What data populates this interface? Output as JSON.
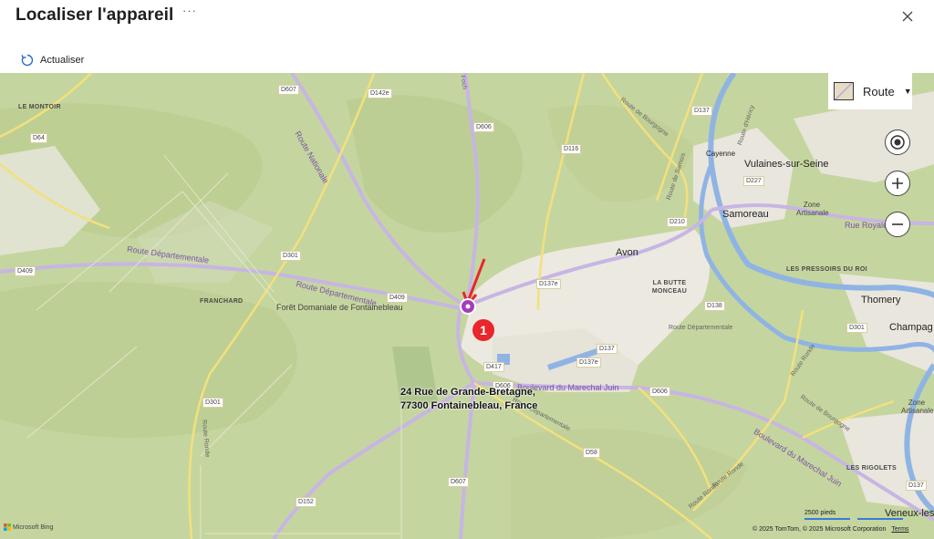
{
  "header": {
    "title": "Localiser l'appareil",
    "more_label": "···",
    "refresh_label": "Actualiser"
  },
  "map": {
    "style_label": "Route",
    "address_line1": "24 Rue de Grande-Bretagne,",
    "address_line2": "77300 Fontainebleau, France",
    "callout_number": "1",
    "towns": {
      "avon": "Avon",
      "vulaines": "Vulaines-sur-Seine",
      "samoreau": "Samoreau",
      "thomery": "Thomery",
      "champagne": "Champag",
      "veneux": "Veneux-les",
      "cayenne": "Cayenne",
      "foret": "Forêt Domaniale de Fontainebleau",
      "zone_artisanale_1": "Zone Artisanale",
      "zone_artisanale_2": "Zone Artisanale"
    },
    "areas": {
      "le_montoir": "LE MONTOIR",
      "franchard": "FRANCHARD",
      "butte_monceau": "LA BUTTE MONCEAU",
      "pressoirs": "LES PRESSOIRS DU ROI",
      "rigolets": "LES RIGOLETS"
    },
    "roads": {
      "route_nationale": "Route Nationale",
      "route_dep_1": "Route Départementale",
      "route_dep_2": "Route Départementale",
      "route_dep_3": "Route Départementale",
      "route_dep_4": "Route Départementale",
      "route_bourgogne_1": "Route de Bourgogne",
      "route_bourgogne_2": "Route de Bourgogne",
      "bd_juin_1": "Boulevard du Marechal Juin",
      "bd_juin_2": "Boulevard du Marechal Juin",
      "route_ronde_1": "Route Ronde",
      "route_ronde_2": "Route Ronde",
      "route_ronde_3": "Route Ronde",
      "route_ronde_4": "Route Ronde",
      "route_royale": "Rue Royale",
      "route_samois": "Route de Samois",
      "route_hericy": "Route d'Héricy",
      "foch": "Foch"
    },
    "shields": {
      "d607_top": "D607",
      "d142e": "D142e",
      "d606_top": "D606",
      "d116": "D116",
      "d137_top": "D137",
      "d227": "D227",
      "d210": "D210",
      "d64": "D64",
      "d409_left": "D409",
      "d301_top": "D301",
      "d409_mid": "D409",
      "d137e_1": "D137e",
      "d138": "D138",
      "d301_right": "D301",
      "d137_mid": "D137",
      "d137e_2": "D137e",
      "d417": "D417",
      "d606_mid": "D606",
      "d606_right": "D606",
      "d301_bottom": "D301",
      "d58": "D58",
      "d607_bottom": "D607",
      "d152": "D152",
      "d137_bottom": "D137"
    },
    "scale_label": "2500 pieds",
    "attribution_left": "Microsoft Bing",
    "copyright": "© 2025 TomTom, © 2025 Microsoft Corporation",
    "terms_label": "Terms"
  },
  "icons": {
    "close": "close-icon",
    "refresh": "refresh-icon",
    "locate": "locate-icon",
    "zoom_in": "zoom-in-icon",
    "zoom_out": "zoom-out-icon"
  }
}
